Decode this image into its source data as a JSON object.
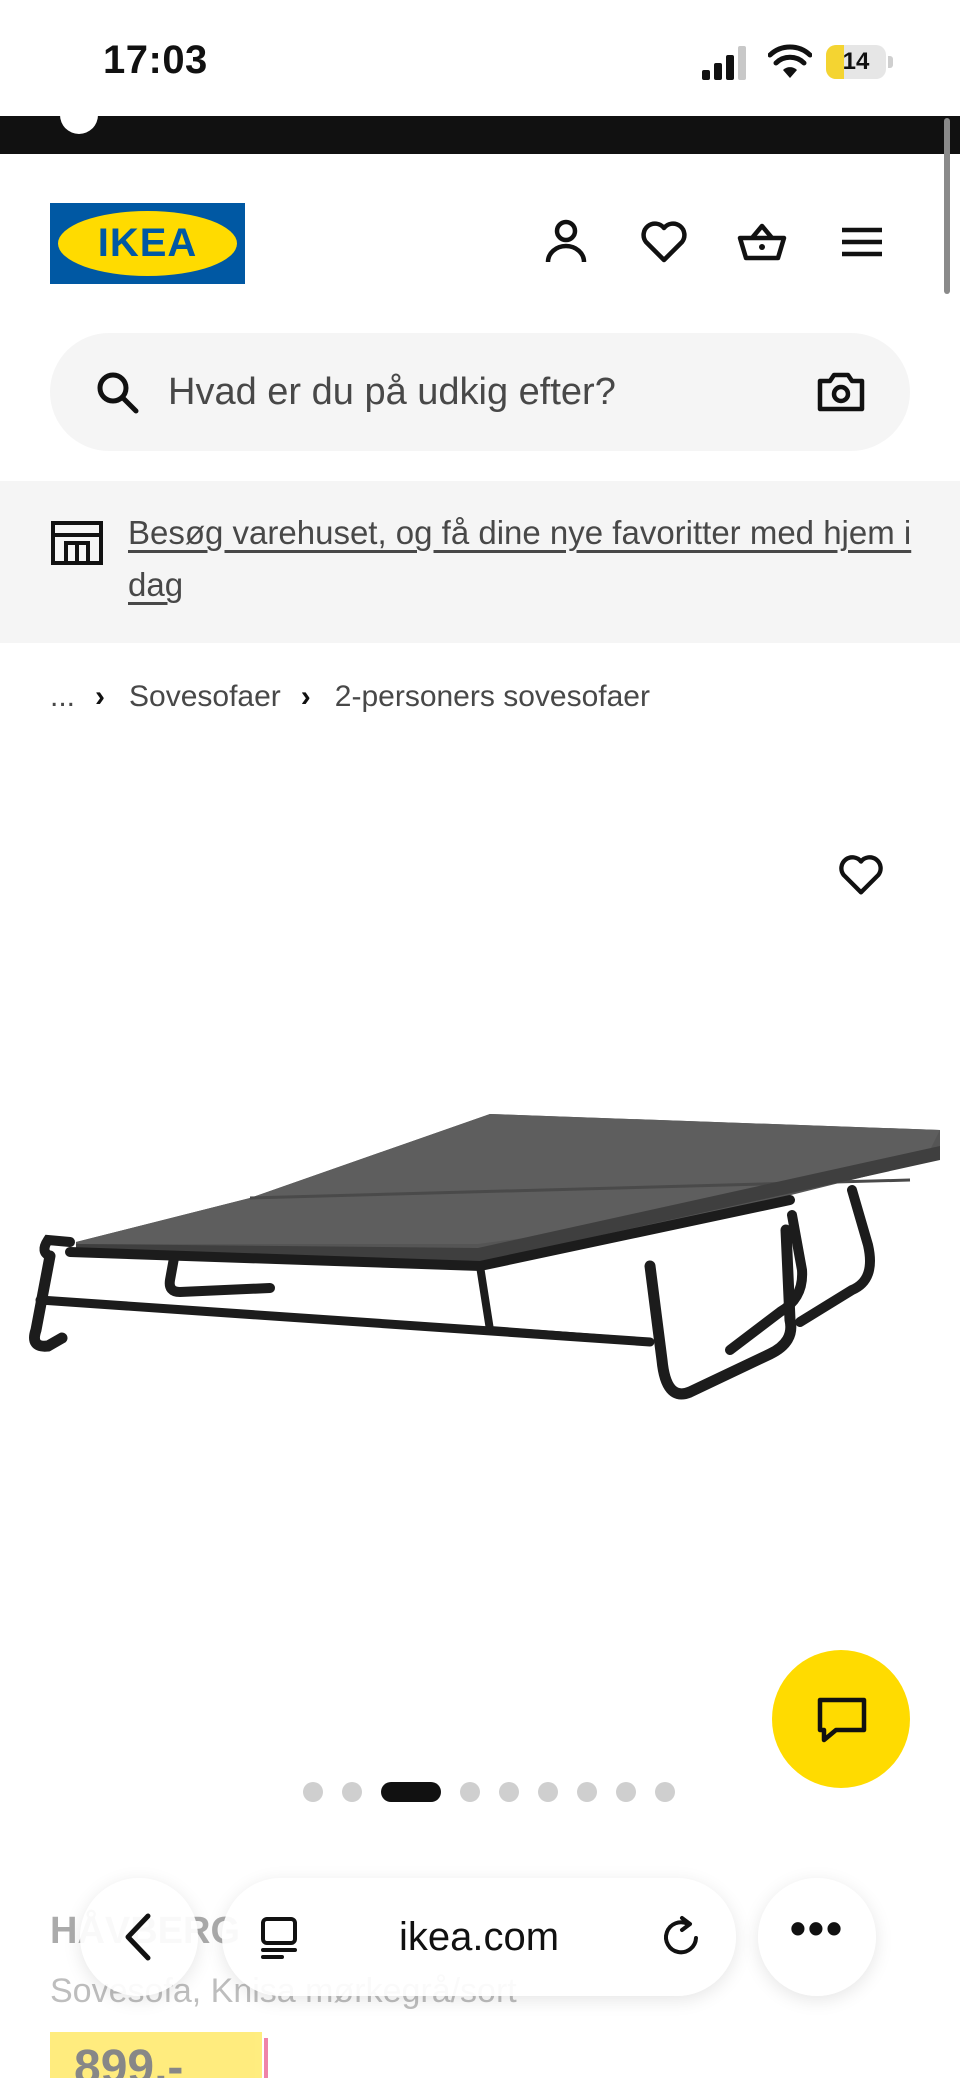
{
  "status_bar": {
    "time": "17:03",
    "battery_level": "14",
    "battery_fill_fraction": 0.14,
    "icons": [
      "signal-icon",
      "wifi-icon",
      "battery-icon"
    ]
  },
  "header": {
    "logo_text": "IKEA",
    "brand_colors": {
      "blue": "#0058a3",
      "yellow": "#ffdb00"
    },
    "icons": [
      "account-icon",
      "heart-icon",
      "basket-icon",
      "menu-icon"
    ]
  },
  "search": {
    "placeholder": "Hvad er du på udkig efter?",
    "icons": [
      "search-icon",
      "camera-icon"
    ]
  },
  "banner": {
    "text": "Besøg varehuset, og få dine nye favoritter med hjem i dag",
    "icon": "store-icon"
  },
  "breadcrumb": {
    "ellipsis": "...",
    "items": [
      "Sovesofaer",
      "2-personers sovesofaer"
    ]
  },
  "gallery": {
    "image_count": 9,
    "active_index": 3,
    "icons": [
      "favorite-heart-icon",
      "chat-icon"
    ]
  },
  "product": {
    "name": "HÅVBERG",
    "description": "Sovesofa, Knisa mørkegrå/sort",
    "price": "899,-"
  },
  "browser": {
    "url": "ikea.com",
    "more_label": "•••",
    "icons": [
      "back-icon",
      "tabs-icon",
      "reload-icon",
      "more-icon"
    ]
  }
}
